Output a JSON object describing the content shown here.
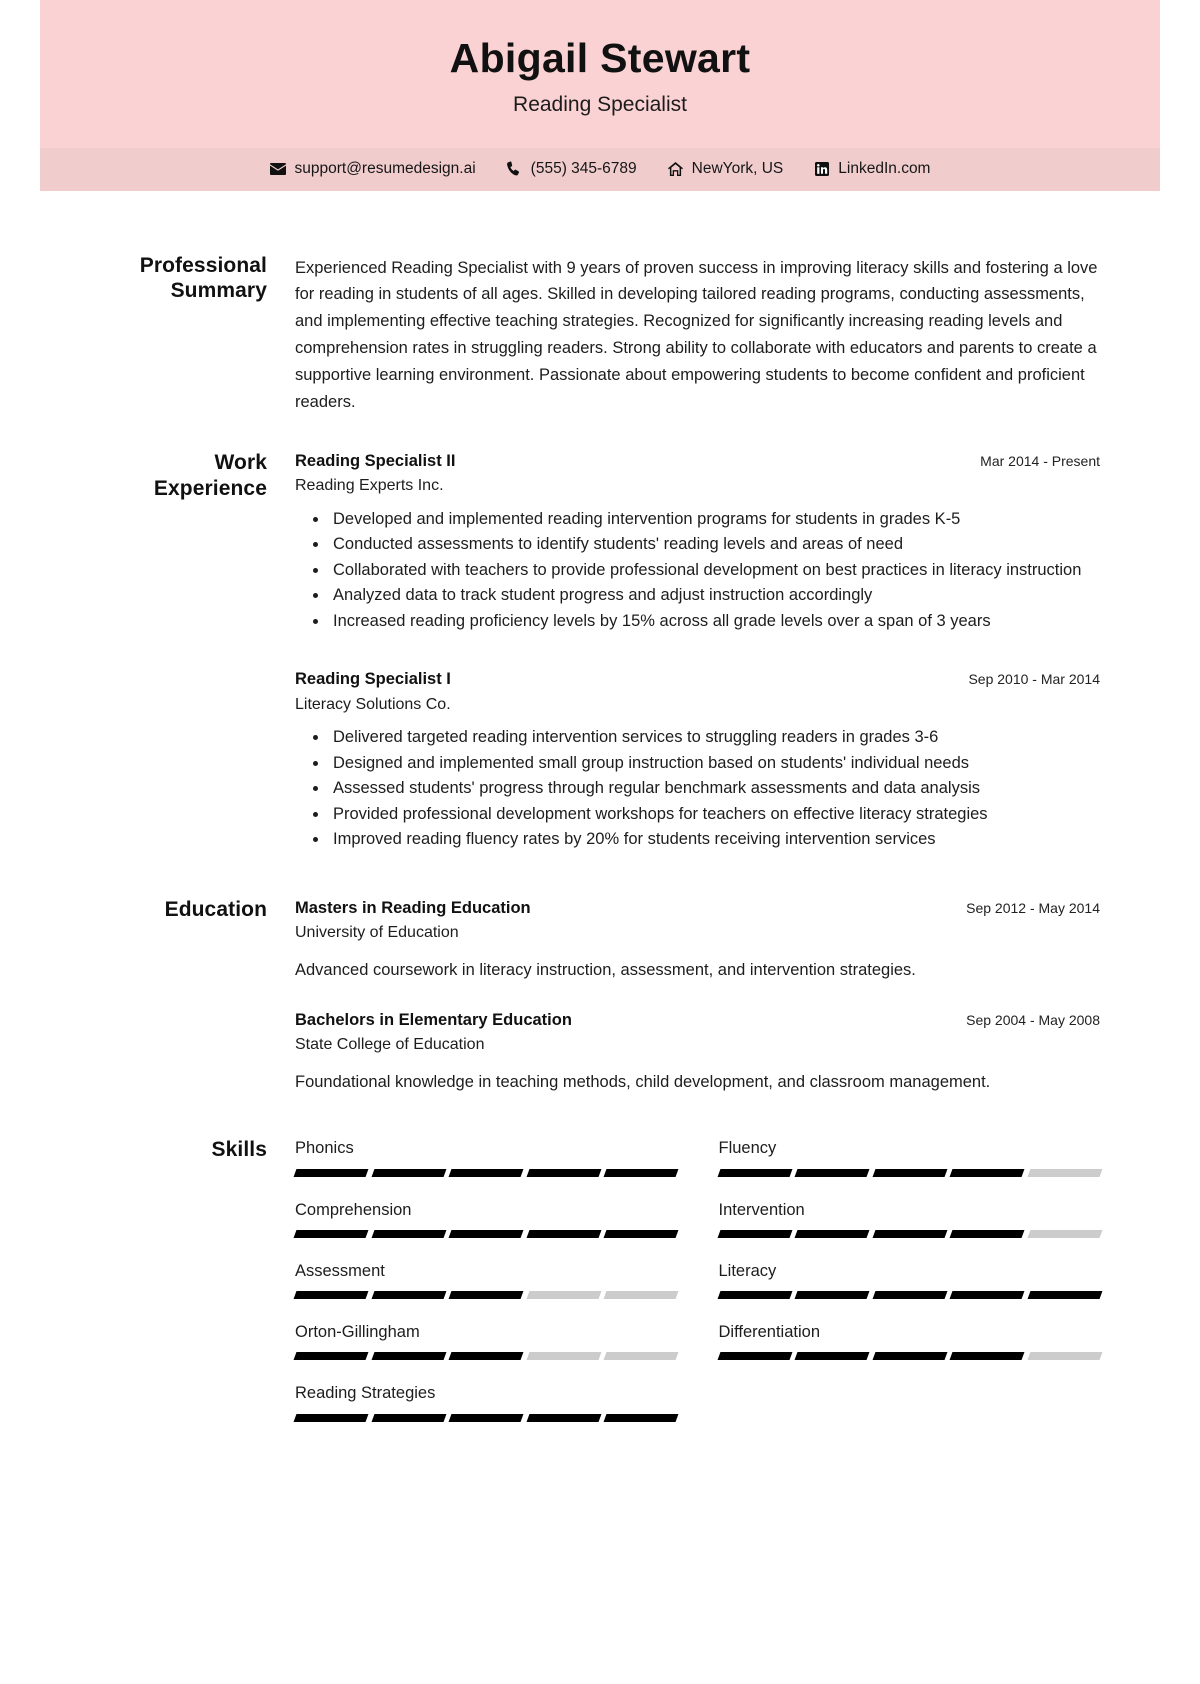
{
  "theme": {
    "header_bg": "#fbd2d3",
    "contact_bg": "#f0cccd",
    "text": "#1d1d1d",
    "skill_filled": "#000000",
    "skill_empty": "#cccccc"
  },
  "header": {
    "name": "Abigail Stewart",
    "job_title": "Reading Specialist"
  },
  "contact": [
    {
      "icon": "envelope-icon",
      "text": "support@resumedesign.ai"
    },
    {
      "icon": "phone-icon",
      "text": "(555) 345-6789"
    },
    {
      "icon": "home-icon",
      "text": "NewYork, US"
    },
    {
      "icon": "linkedin-icon",
      "text": "LinkedIn.com"
    }
  ],
  "summary": {
    "label": "Professional Summary",
    "text": "Experienced Reading Specialist with 9 years of proven success in improving literacy skills and fostering a love for reading in students of all ages. Skilled in developing tailored reading programs, conducting assessments, and implementing effective teaching strategies. Recognized for significantly increasing reading levels and comprehension rates in struggling readers. Strong ability to collaborate with educators and parents to create a supportive learning environment. Passionate about empowering students to become confident and proficient readers."
  },
  "work": {
    "label": "Work Experience",
    "entries": [
      {
        "title": "Reading Specialist II",
        "company": "Reading Experts Inc.",
        "date": "Mar 2014 - Present",
        "bullets": [
          "Developed and implemented reading intervention programs for students in grades K-5",
          "Conducted assessments to identify students' reading levels and areas of need",
          "Collaborated with teachers to provide professional development on best practices in literacy instruction",
          "Analyzed data to track student progress and adjust instruction accordingly",
          "Increased reading proficiency levels by 15% across all grade levels over a span of 3 years"
        ]
      },
      {
        "title": "Reading Specialist I",
        "company": "Literacy Solutions Co.",
        "date": "Sep 2010 - Mar 2014",
        "bullets": [
          "Delivered targeted reading intervention services to struggling readers in grades 3-6",
          "Designed and implemented small group instruction based on students' individual needs",
          "Assessed students' progress through regular benchmark assessments and data analysis",
          "Provided professional development workshops for teachers on effective literacy strategies",
          "Improved reading fluency rates by 20% for students receiving intervention services"
        ]
      }
    ]
  },
  "education": {
    "label": "Education",
    "entries": [
      {
        "title": "Masters in Reading Education",
        "school": "University of Education",
        "date": "Sep 2012 - May 2014",
        "description": "Advanced coursework in literacy instruction, assessment, and intervention strategies."
      },
      {
        "title": "Bachelors in Elementary Education",
        "school": "State College of Education",
        "date": "Sep 2004 - May 2008",
        "description": "Foundational knowledge in teaching methods, child development, and classroom management."
      }
    ]
  },
  "skills": {
    "label": "Skills",
    "max_level": 5,
    "items": [
      {
        "name": "Phonics",
        "level": 5
      },
      {
        "name": "Fluency",
        "level": 4
      },
      {
        "name": "Comprehension",
        "level": 5
      },
      {
        "name": "Intervention",
        "level": 4
      },
      {
        "name": "Assessment",
        "level": 3
      },
      {
        "name": "Literacy",
        "level": 5
      },
      {
        "name": "Orton-Gillingham",
        "level": 3
      },
      {
        "name": "Differentiation",
        "level": 4
      },
      {
        "name": "Reading Strategies",
        "level": 5
      }
    ]
  }
}
